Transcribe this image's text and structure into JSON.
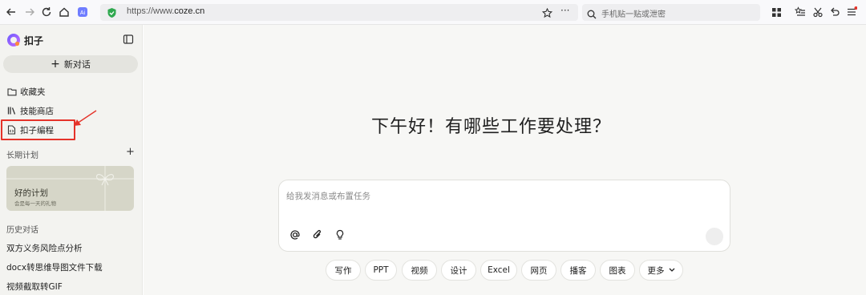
{
  "browser": {
    "url_prefix": "https://www.",
    "url_domain": "coze.cn",
    "search_placeholder": "手机贴一贴或泄密"
  },
  "sidebar": {
    "app_name": "扣子",
    "new_chat_label": "新对话",
    "items": [
      {
        "label": "收藏夹",
        "icon": "folder-icon"
      },
      {
        "label": "技能商店",
        "icon": "library-icon"
      },
      {
        "label": "扣子编程",
        "icon": "code-file-icon"
      }
    ],
    "plan_section_label": "长期计划",
    "plan_card": {
      "title": "好的计划",
      "subtitle": "会是每一天的礼物"
    },
    "history_label": "历史对话",
    "history": [
      "双方义务风险点分析",
      "docx转思维导图文件下载",
      "视频截取转GIF"
    ]
  },
  "main": {
    "greeting": "下午好！有哪些工作要处理？",
    "composer_placeholder": "给我发消息或布置任务",
    "chips": [
      "写作",
      "PPT",
      "视频",
      "设计",
      "Excel",
      "网页",
      "播客",
      "图表",
      "更多"
    ]
  },
  "colors": {
    "highlight": "#e5332a",
    "shield_green": "#2fa84f",
    "accent_purple": "#7b61ff"
  }
}
